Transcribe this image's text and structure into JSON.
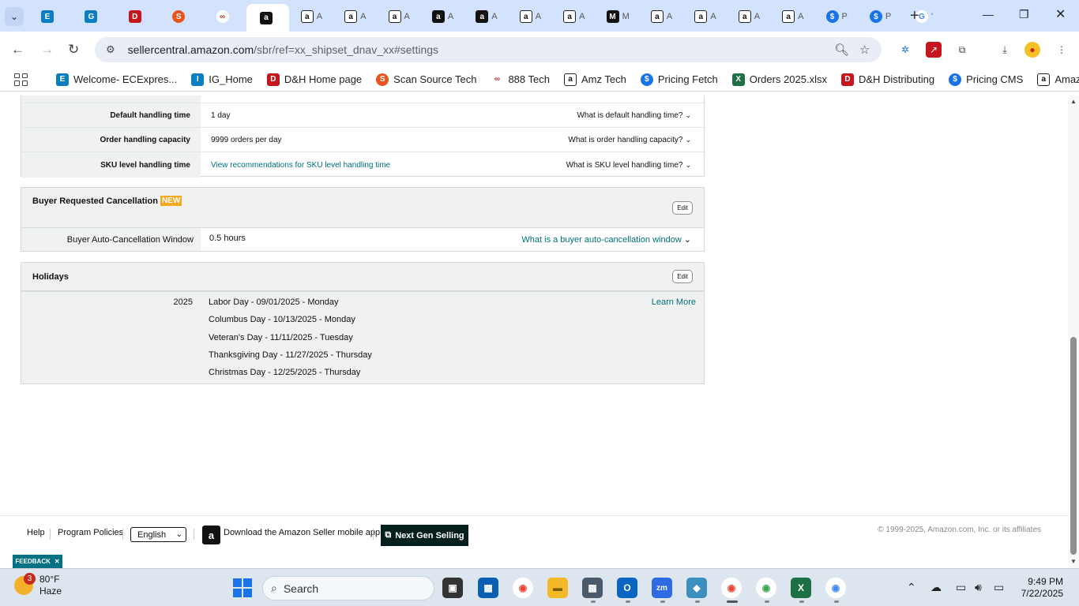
{
  "browser": {
    "tabs": [
      {
        "title": "",
        "favicon": "ec"
      },
      {
        "title": "",
        "favicon": "ig-blue"
      },
      {
        "title": "",
        "favicon": "dh"
      },
      {
        "title": "",
        "favicon": "scansource"
      },
      {
        "title": "",
        "favicon": "888"
      },
      {
        "title": "",
        "favicon": "amazon-black",
        "active": true
      },
      {
        "title": "A",
        "favicon": "amazon"
      },
      {
        "title": "A",
        "favicon": "amazon"
      },
      {
        "title": "A",
        "favicon": "amazon"
      },
      {
        "title": "A",
        "favicon": "amazon-black"
      },
      {
        "title": "A",
        "favicon": "amazon-black"
      },
      {
        "title": "A",
        "favicon": "amazon"
      },
      {
        "title": "A",
        "favicon": "amazon"
      },
      {
        "title": "M",
        "favicon": "m-black"
      },
      {
        "title": "A",
        "favicon": "amazon"
      },
      {
        "title": "A",
        "favicon": "amazon"
      },
      {
        "title": "A",
        "favicon": "amazon"
      },
      {
        "title": "A",
        "favicon": "amazon"
      },
      {
        "title": "P",
        "favicon": "dollar"
      },
      {
        "title": "P",
        "favicon": "dollar"
      },
      {
        "title": "'",
        "favicon": "google"
      }
    ],
    "url_host": "sellercentral.amazon.com",
    "url_path": "/sbr/ref=xx_shipset_dnav_xx#settings",
    "bookmarks": [
      {
        "label": "Welcome- ECExpres...",
        "favicon": "ec"
      },
      {
        "label": "IG_Home",
        "favicon": "ig"
      },
      {
        "label": "D&H Home page",
        "favicon": "dh"
      },
      {
        "label": "Scan Source Tech",
        "favicon": "scansource"
      },
      {
        "label": "888 Tech",
        "favicon": "888"
      },
      {
        "label": "Amz Tech",
        "favicon": "amazon"
      },
      {
        "label": "Pricing Fetch",
        "favicon": "dollar"
      },
      {
        "label": "Orders 2025.xlsx",
        "favicon": "excel"
      },
      {
        "label": "D&H Distributing",
        "favicon": "dh"
      },
      {
        "label": "Pricing CMS",
        "favicon": "dollar"
      },
      {
        "label": "Amazon",
        "favicon": "amazon"
      }
    ]
  },
  "handling": {
    "rows": [
      {
        "label": "Default handling time",
        "value": "1 day",
        "help": "What is default handling time?"
      },
      {
        "label": "Order handling capacity",
        "value": "9999 orders per day",
        "help": "What is order handling capacity?"
      },
      {
        "label": "SKU level handling time",
        "value": "View recommendations for SKU level handling time",
        "help": "What is SKU level handling time?"
      }
    ]
  },
  "cancellation": {
    "title": "Buyer Requested Cancellation",
    "badge": "NEW",
    "edit": "Edit",
    "row_label": "Buyer Auto-Cancellation Window",
    "row_value": "0.5 hours",
    "row_help": "What is a buyer auto-cancellation window"
  },
  "holidays": {
    "title": "Holidays",
    "edit": "Edit",
    "year": "2025",
    "learn_more": "Learn More",
    "items": [
      "Labor Day - 09/01/2025 - Monday",
      "Columbus Day - 10/13/2025 - Monday",
      "Veteran's Day - 11/11/2025 - Tuesday",
      "Thanksgiving Day - 11/27/2025 - Thursday",
      "Christmas Day - 12/25/2025 - Thursday"
    ]
  },
  "footer": {
    "help": "Help",
    "policies": "Program Policies",
    "language": "English",
    "app_download": "Download the Amazon Seller mobile app",
    "next_gen": "Next Gen Selling",
    "copyright": "© 1999-2025, Amazon.com, Inc. or its affiliates",
    "feedback": "FEEDBACK"
  },
  "taskbar": {
    "weather_temp": "80°F",
    "weather_desc": "Haze",
    "weather_badge": "3",
    "search_placeholder": "Search",
    "time": "9:49 PM",
    "date": "7/22/2025"
  }
}
